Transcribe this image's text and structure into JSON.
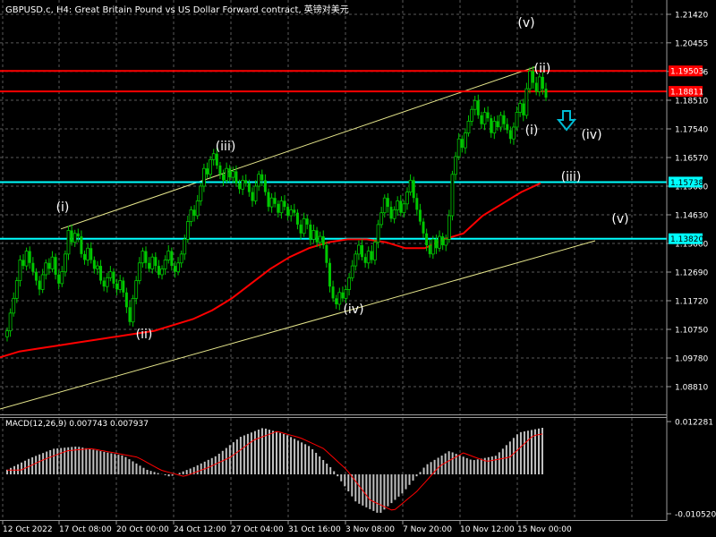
{
  "header": {
    "symbol_title": "GBPUSD.c, H4:  Great Britain Pound vs US Dollar Forward contract, 英镑对美元"
  },
  "macd_panel": {
    "label": "MACD(12,26,9) 0.007743 0.007937",
    "yticks": [
      "0.012281",
      "-0.010520"
    ]
  },
  "colors": {
    "background": "#000000",
    "grid": "#5a5a5a",
    "candle": "#00c800",
    "moving_average": "#ff0000",
    "channel": "#e6e68c",
    "resistance": "#ff0000",
    "support": "#00ffff",
    "macd_hist": "#c0c0c0",
    "macd_signal": "#ff0000",
    "arrow": "#00bcd4"
  },
  "chart_data": {
    "type": "candlestick",
    "x_labels": [
      "12 Oct 2022",
      "17 Oct 08:00",
      "20 Oct 00:00",
      "24 Oct 12:00",
      "27 Oct 04:00",
      "31 Oct 16:00",
      "3 Nov 08:00",
      "7 Nov 20:00",
      "10 Nov 12:00",
      "15 Nov 00:00"
    ],
    "y_ticks": [
      "1.21420",
      "1.20455",
      "1.19486",
      "1.18510",
      "1.17540",
      "1.16570",
      "1.15600",
      "1.14630",
      "1.13660",
      "1.12690",
      "1.11720",
      "1.10750",
      "1.09780",
      "1.08810"
    ],
    "ylim": [
      1.0825,
      1.2175
    ],
    "price_lines": [
      {
        "price": 1.19503,
        "label": "1.19503",
        "kind": "resistance"
      },
      {
        "price": 1.18811,
        "label": "1.18811",
        "kind": "current"
      },
      {
        "price": 1.15738,
        "label": "1.15738",
        "kind": "support"
      },
      {
        "price": 1.1382,
        "label": "1.13820",
        "kind": "support"
      }
    ],
    "close_series": [
      1.107,
      1.113,
      1.118,
      1.124,
      1.131,
      1.129,
      1.134,
      1.13,
      1.127,
      1.124,
      1.121,
      1.126,
      1.13,
      1.128,
      1.132,
      1.126,
      1.123,
      1.127,
      1.133,
      1.141,
      1.137,
      1.14,
      1.139,
      1.133,
      1.131,
      1.135,
      1.131,
      1.128,
      1.129,
      1.124,
      1.122,
      1.125,
      1.127,
      1.123,
      1.121,
      1.124,
      1.12,
      1.115,
      1.11,
      1.118,
      1.124,
      1.13,
      1.134,
      1.13,
      1.128,
      1.132,
      1.129,
      1.126,
      1.128,
      1.131,
      1.134,
      1.129,
      1.127,
      1.13,
      1.133,
      1.138,
      1.144,
      1.148,
      1.146,
      1.151,
      1.156,
      1.162,
      1.16,
      1.165,
      1.167,
      1.163,
      1.16,
      1.158,
      1.162,
      1.159,
      1.161,
      1.157,
      1.155,
      1.158,
      1.157,
      1.154,
      1.151,
      1.156,
      1.16,
      1.158,
      1.154,
      1.149,
      1.152,
      1.15,
      1.147,
      1.151,
      1.149,
      1.146,
      1.148,
      1.147,
      1.143,
      1.14,
      1.145,
      1.143,
      1.138,
      1.141,
      1.137,
      1.139,
      1.136,
      1.13,
      1.122,
      1.118,
      1.116,
      1.12,
      1.118,
      1.121,
      1.125,
      1.129,
      1.133,
      1.136,
      1.132,
      1.13,
      1.134,
      1.131,
      1.137,
      1.143,
      1.147,
      1.152,
      1.149,
      1.145,
      1.148,
      1.151,
      1.147,
      1.15,
      1.154,
      1.158,
      1.152,
      1.148,
      1.144,
      1.14,
      1.136,
      1.133,
      1.138,
      1.135,
      1.139,
      1.136,
      1.138,
      1.146,
      1.16,
      1.166,
      1.172,
      1.169,
      1.174,
      1.178,
      1.182,
      1.185,
      1.18,
      1.177,
      1.181,
      1.179,
      1.174,
      1.178,
      1.176,
      1.18,
      1.177,
      1.175,
      1.172,
      1.176,
      1.181,
      1.184,
      1.18,
      1.189,
      1.195,
      1.191,
      1.188,
      1.193,
      1.189,
      1.186
    ],
    "moving_average": [
      1.098,
      1.1,
      1.101,
      1.102,
      1.103,
      1.104,
      1.105,
      1.106,
      1.107,
      1.109,
      1.111,
      1.114,
      1.118,
      1.123,
      1.128,
      1.132,
      1.135,
      1.137,
      1.138,
      1.138,
      1.137,
      1.135,
      1.135,
      1.138,
      1.14,
      1.146,
      1.15,
      1.154,
      1.157
    ],
    "channel": {
      "upper": [
        [
          1.1415,
          1.1964
        ]
      ],
      "lower": [
        [
          1.0805,
          1.1375
        ]
      ]
    },
    "wave_labels": [
      "(i)",
      "(ii)",
      "(iii)",
      "(iv)",
      "(v)",
      "(ii)",
      "(i)",
      "(iv)",
      "(iii)",
      "(v)"
    ],
    "ma_period": ""
  }
}
